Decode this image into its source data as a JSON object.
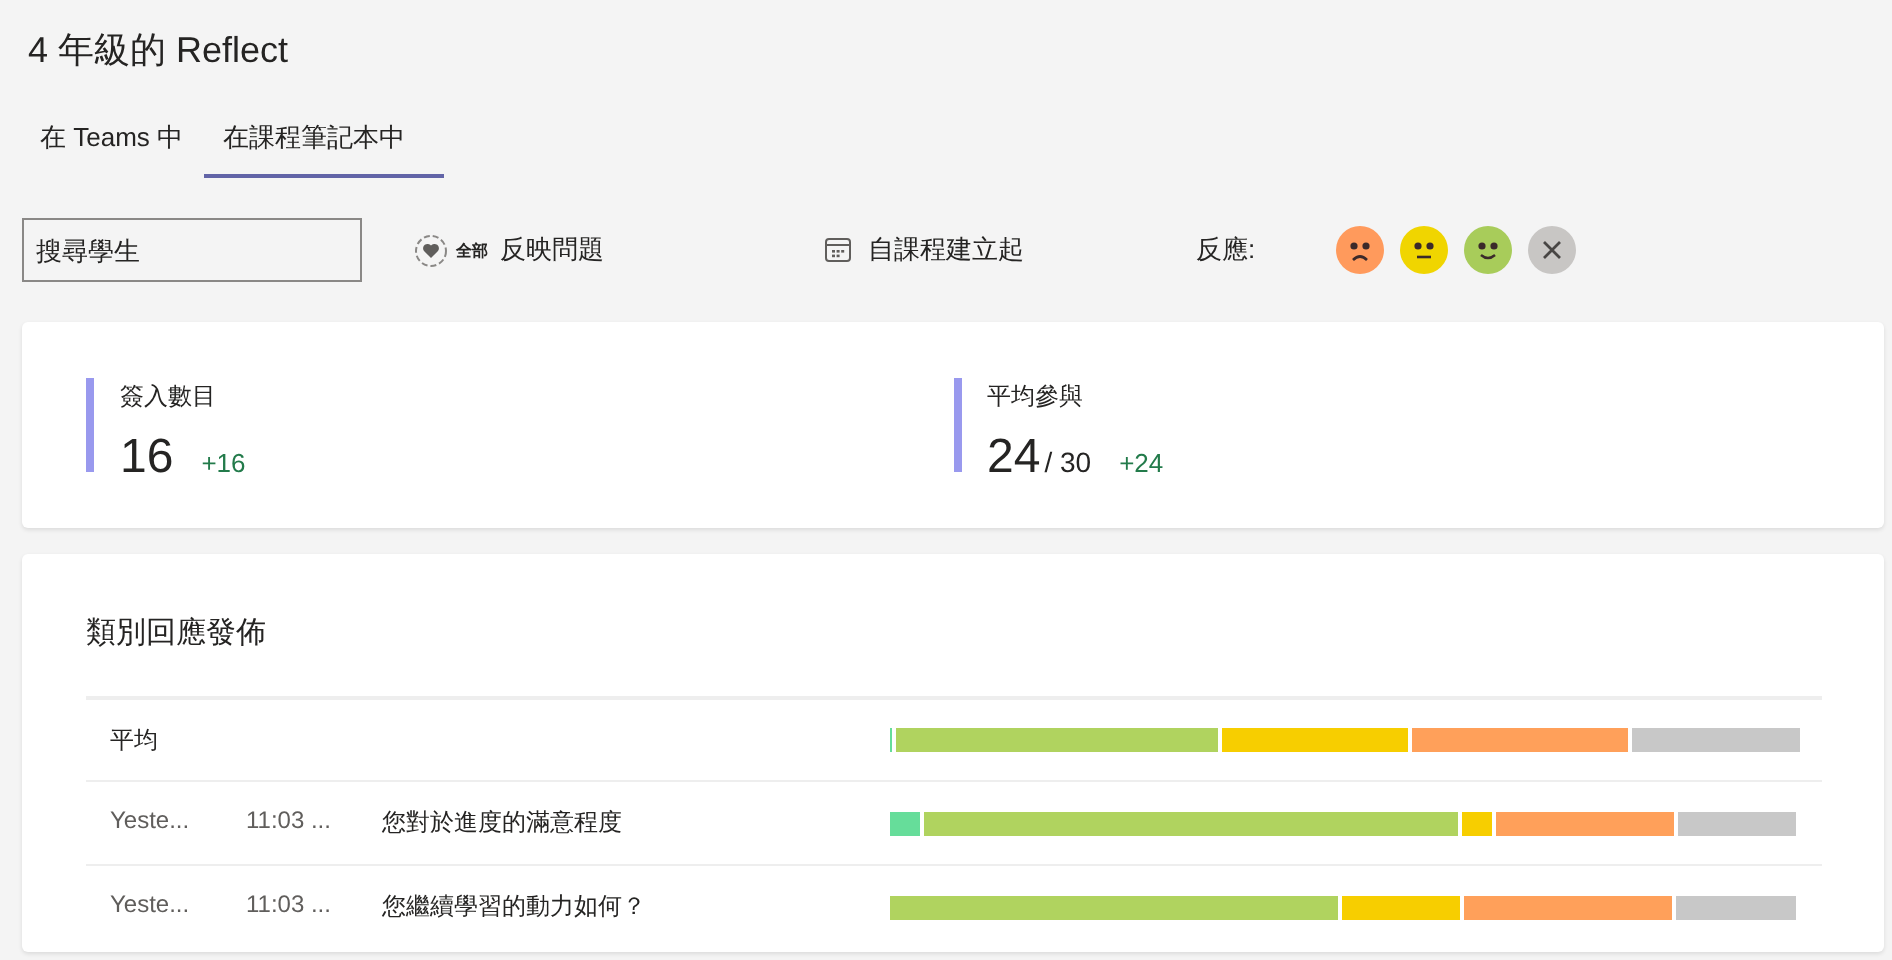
{
  "title": "4 年級的 Reflect",
  "tabs": [
    {
      "label": "在 Teams 中",
      "selected": false
    },
    {
      "label": "在課程筆記本中",
      "selected": true
    }
  ],
  "toolbar": {
    "search": {
      "placeholder": "搜尋學生"
    },
    "questions_badge": "全部",
    "questions": "反映問題",
    "date_range": "自課程建立起",
    "reactions_label": "反應:"
  },
  "reactions": [
    {
      "kind": "sad",
      "color": "#ff9a5c"
    },
    {
      "kind": "neutral",
      "color": "#f0d500"
    },
    {
      "kind": "happy",
      "color": "#a8cc5a"
    },
    {
      "kind": "none",
      "color": "#c8c6c4"
    }
  ],
  "stats": [
    {
      "label": "簽入數目",
      "value": "16",
      "delta": "+16"
    },
    {
      "label": "平均參與",
      "value": "24",
      "total": "/ 30",
      "delta": "+24"
    }
  ],
  "distribution": {
    "title": "類別回應發佈",
    "rows": [
      {
        "kind": "average",
        "label": "平均"
      },
      {
        "kind": "question",
        "date": "Yeste...",
        "time": "11:03 ...",
        "label": "您對於進度的滿意程度"
      },
      {
        "kind": "question",
        "date": "Yeste...",
        "time": "11:03 ...",
        "label": "您繼續學習的動力如何？"
      }
    ]
  }
}
